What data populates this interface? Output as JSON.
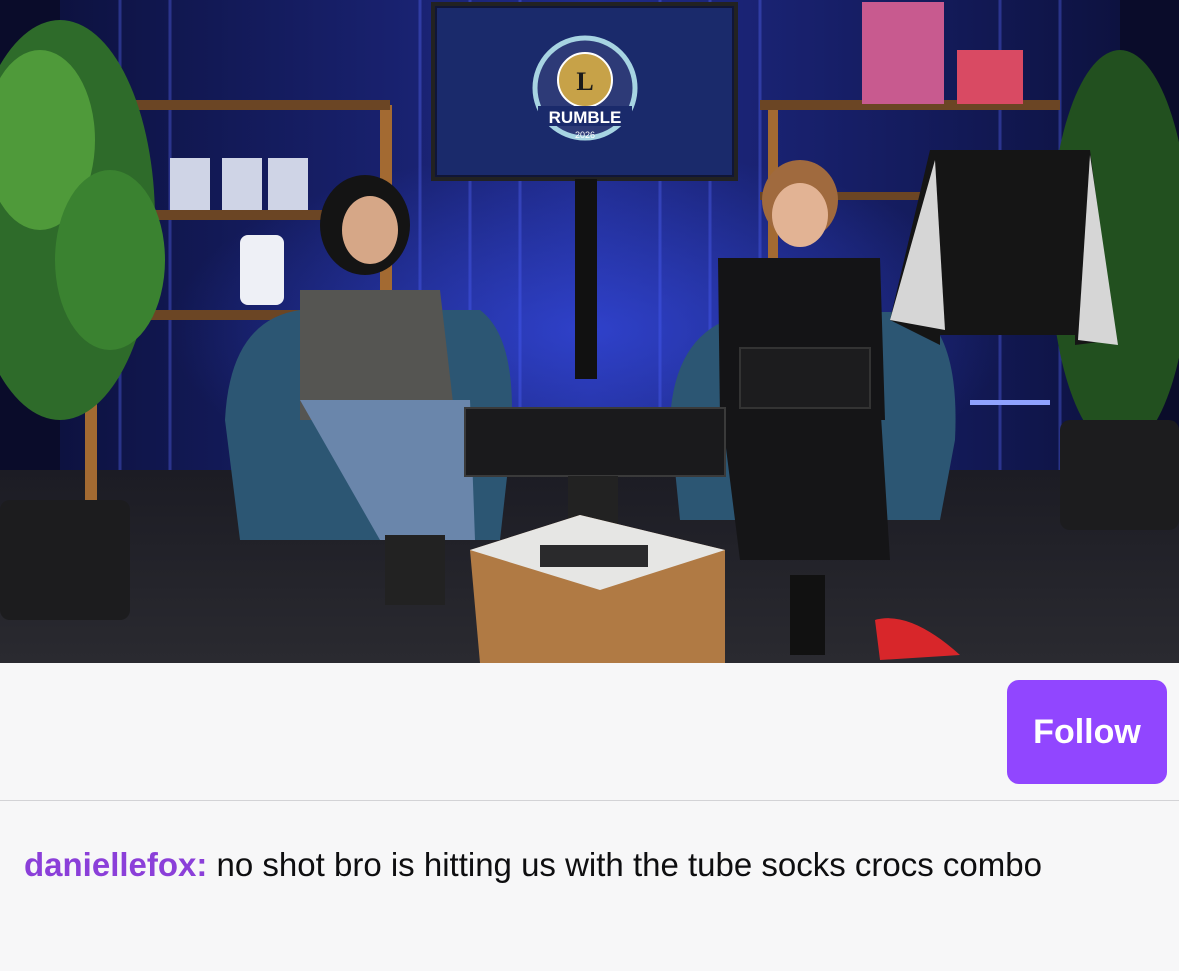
{
  "stream": {
    "screen_logo_text": "RUMBLE",
    "screen_logo_year": "2026"
  },
  "follow_button": {
    "label": "Follow"
  },
  "chat_message": {
    "username": "daniellefox",
    "separator": ":",
    "text": " no shot bro is hitting us with the tube socks crocs combo"
  },
  "colors": {
    "accent": "#9146ff",
    "username": "#8b3fd9"
  }
}
